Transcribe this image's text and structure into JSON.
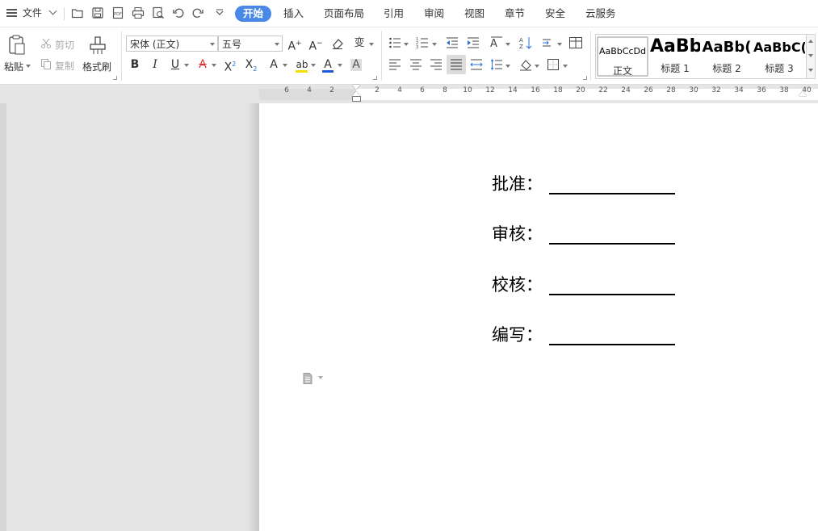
{
  "menubar": {
    "file_label": "文件",
    "tabs": [
      "开始",
      "插入",
      "页面布局",
      "引用",
      "审阅",
      "视图",
      "章节",
      "安全",
      "云服务"
    ]
  },
  "ribbon": {
    "paste": "粘贴",
    "cut": "剪切",
    "copy": "复制",
    "format_painter": "格式刷",
    "font_name": "宋体 (正文)",
    "font_size": "五号",
    "styles": [
      {
        "sample": "AaBbCcDd",
        "name": "正文"
      },
      {
        "sample": "AaBb",
        "name": "标题 1"
      },
      {
        "sample": "AaBb(",
        "name": "标题 2"
      },
      {
        "sample": "AaBbC(",
        "name": "标题 3"
      }
    ]
  },
  "ruler": {
    "ticks": [
      "6",
      "4",
      "2",
      "2",
      "4",
      "6",
      "8",
      "10",
      "12",
      "14",
      "16",
      "18",
      "20",
      "22",
      "24",
      "26",
      "28",
      "30",
      "32",
      "34",
      "36",
      "38",
      "40"
    ]
  },
  "document": {
    "lines": [
      {
        "label": "批准："
      },
      {
        "label": "审核："
      },
      {
        "label": "校核："
      },
      {
        "label": "编写："
      }
    ]
  },
  "colors": {
    "accent": "#4a88e8",
    "font_color_bar": "#1e5bd6",
    "highlight_bar": "#f5e100",
    "text_effect_bar": "#e03030"
  }
}
